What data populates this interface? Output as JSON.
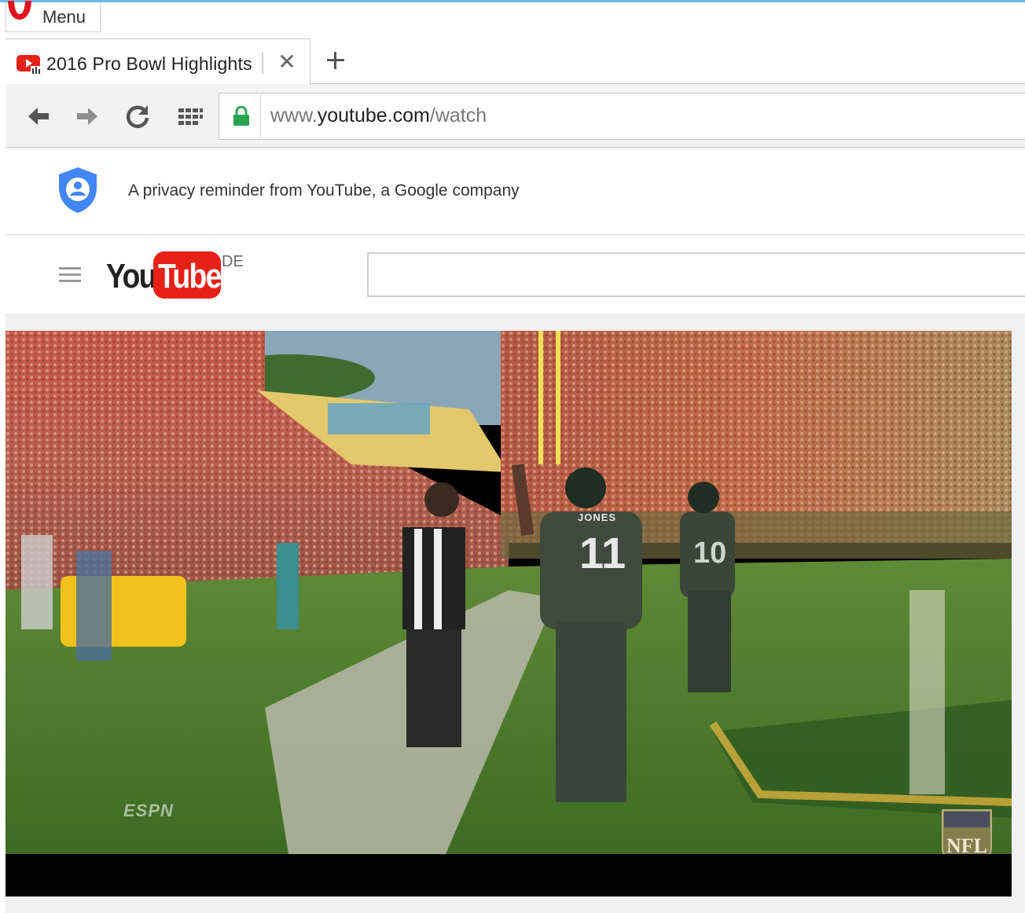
{
  "browser": {
    "menu_label": "Menu",
    "tab": {
      "title": "2016 Pro Bowl Highlights",
      "close_glyph": "✕"
    },
    "new_tab_glyph": "+",
    "address": {
      "url_prefix": "www.",
      "url_host": "youtube.com",
      "url_path": "/watch"
    },
    "icons": [
      "opera-logo-icon",
      "youtube-favicon-icon",
      "back-arrow-icon",
      "forward-arrow-icon",
      "reload-icon",
      "speed-dial-icon",
      "lock-icon"
    ]
  },
  "privacy": {
    "text": "A privacy reminder from YouTube, a Google company",
    "icon": "shield-person-icon"
  },
  "youtube": {
    "logo_you": "You",
    "logo_tube": "Tube",
    "country": "DE",
    "search_value": "",
    "brand_color": "#e62117"
  },
  "video": {
    "espn_bug": "ESPN",
    "nfl_logo": "NFL",
    "player_numbers": [
      "11",
      "10"
    ],
    "player_name": "JONES"
  },
  "colors": {
    "accent_blue": "#4285f4",
    "lock_green": "#2aa44f",
    "field_green": "#4d7a2b"
  }
}
